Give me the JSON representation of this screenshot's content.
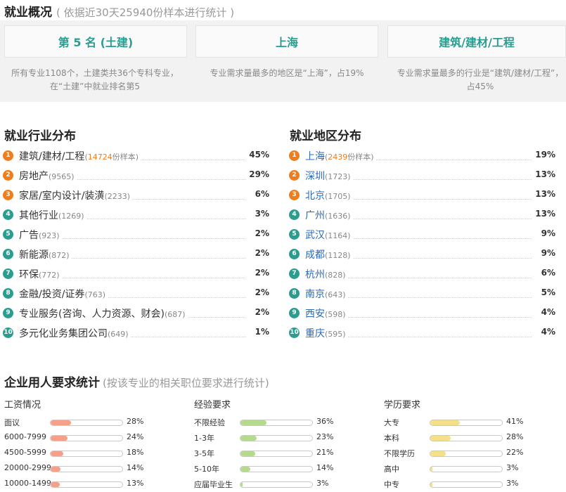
{
  "overview": {
    "title": "就业概况",
    "subtitle": "( 依据近30天25940份样本进行统计 )",
    "cards": [
      {
        "label": "第 5 名 (土建)",
        "desc": "所有专业1108个，土建类共36个专科专业，在“土建”中就业排名第5"
      },
      {
        "label": "上海",
        "desc": "专业需求量最多的地区是“上海”，占19%"
      },
      {
        "label": "建筑/建材/工程",
        "desc": "专业需求量最多的行业是“建筑/建材/工程”，占45%"
      }
    ]
  },
  "industry": {
    "title": "就业行业分布",
    "items": [
      {
        "rank": "1",
        "name": "建筑/建材/工程",
        "count": "14724",
        "suffix": "份样本",
        "pct": "45%"
      },
      {
        "rank": "2",
        "name": "房地产",
        "count": "9565",
        "suffix": "",
        "pct": "29%"
      },
      {
        "rank": "3",
        "name": "家居/室内设计/装潢",
        "count": "2233",
        "suffix": "",
        "pct": "6%"
      },
      {
        "rank": "4",
        "name": "其他行业",
        "count": "1269",
        "suffix": "",
        "pct": "3%"
      },
      {
        "rank": "5",
        "name": "广告",
        "count": "923",
        "suffix": "",
        "pct": "2%"
      },
      {
        "rank": "6",
        "name": "新能源",
        "count": "872",
        "suffix": "",
        "pct": "2%"
      },
      {
        "rank": "7",
        "name": "环保",
        "count": "772",
        "suffix": "",
        "pct": "2%"
      },
      {
        "rank": "8",
        "name": "金融/投资/证券",
        "count": "763",
        "suffix": "",
        "pct": "2%"
      },
      {
        "rank": "9",
        "name": "专业服务(咨询、人力资源、财会)",
        "count": "687",
        "suffix": "",
        "pct": "2%"
      },
      {
        "rank": "10",
        "name": "多元化业务集团公司",
        "count": "649",
        "suffix": "",
        "pct": "1%"
      }
    ]
  },
  "region": {
    "title": "就业地区分布",
    "items": [
      {
        "rank": "1",
        "name": "上海",
        "count": "2439",
        "suffix": "份样本",
        "pct": "19%"
      },
      {
        "rank": "2",
        "name": "深圳",
        "count": "1723",
        "suffix": "",
        "pct": "13%"
      },
      {
        "rank": "3",
        "name": "北京",
        "count": "1705",
        "suffix": "",
        "pct": "13%"
      },
      {
        "rank": "4",
        "name": "广州",
        "count": "1636",
        "suffix": "",
        "pct": "13%"
      },
      {
        "rank": "5",
        "name": "武汉",
        "count": "1164",
        "suffix": "",
        "pct": "9%"
      },
      {
        "rank": "6",
        "name": "成都",
        "count": "1128",
        "suffix": "",
        "pct": "9%"
      },
      {
        "rank": "7",
        "name": "杭州",
        "count": "828",
        "suffix": "",
        "pct": "6%"
      },
      {
        "rank": "8",
        "name": "南京",
        "count": "643",
        "suffix": "",
        "pct": "5%"
      },
      {
        "rank": "9",
        "name": "西安",
        "count": "598",
        "suffix": "",
        "pct": "4%"
      },
      {
        "rank": "10",
        "name": "重庆",
        "count": "595",
        "suffix": "",
        "pct": "4%"
      }
    ]
  },
  "requirements": {
    "title": "企业用人要求统计",
    "subtitle": "(按该专业的相关职位要求进行统计)",
    "groups": [
      {
        "name": "salary",
        "title": "工资情况",
        "color": "#f4a08a",
        "items": [
          {
            "label": "面议",
            "pct": "28%",
            "value": 0.28
          },
          {
            "label": "6000-7999",
            "pct": "24%",
            "value": 0.24
          },
          {
            "label": "4500-5999",
            "pct": "18%",
            "value": 0.18
          },
          {
            "label": "20000-2999",
            "pct": "14%",
            "value": 0.14
          },
          {
            "label": "10000-1499",
            "pct": "13%",
            "value": 0.13
          }
        ]
      },
      {
        "name": "experience",
        "title": "经验要求",
        "color": "#b5d98e",
        "items": [
          {
            "label": "不限经验",
            "pct": "36%",
            "value": 0.36
          },
          {
            "label": "1-3年",
            "pct": "23%",
            "value": 0.23
          },
          {
            "label": "3-5年",
            "pct": "21%",
            "value": 0.21
          },
          {
            "label": "5-10年",
            "pct": "14%",
            "value": 0.14
          },
          {
            "label": "应届毕业生",
            "pct": "3%",
            "value": 0.03
          }
        ]
      },
      {
        "name": "education",
        "title": "学历要求",
        "color": "#f5e08a",
        "items": [
          {
            "label": "大专",
            "pct": "41%",
            "value": 0.41
          },
          {
            "label": "本科",
            "pct": "28%",
            "value": 0.28
          },
          {
            "label": "不限学历",
            "pct": "22%",
            "value": 0.22
          },
          {
            "label": "高中",
            "pct": "3%",
            "value": 0.03
          },
          {
            "label": "中专",
            "pct": "3%",
            "value": 0.03
          }
        ]
      }
    ]
  }
}
